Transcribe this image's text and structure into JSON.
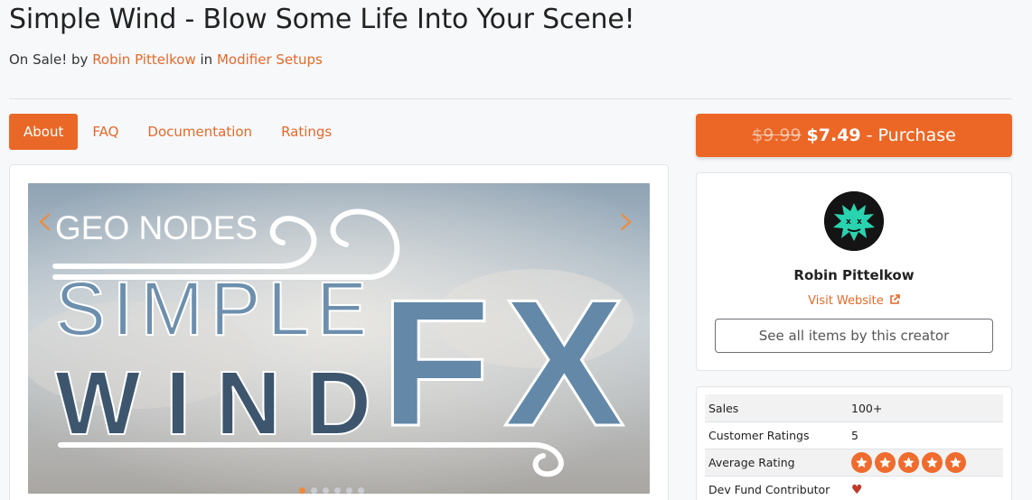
{
  "page": {
    "title": "Simple Wind - Blow Some Life Into Your Scene!",
    "status": "On Sale!",
    "by_word": "by",
    "author": "Robin Pittelkow",
    "in_word": "in",
    "category": "Modifier Setups"
  },
  "tabs": [
    {
      "label": "About",
      "active": true
    },
    {
      "label": "FAQ",
      "active": false
    },
    {
      "label": "Documentation",
      "active": false
    },
    {
      "label": "Ratings",
      "active": false
    }
  ],
  "hero": {
    "line1": "GEO NODES",
    "line2": "SIMPLE",
    "line3": "WIND",
    "line4": "FX",
    "slide_count": 6,
    "active_slide": 0
  },
  "purchase": {
    "old_price": "$9.99",
    "new_price": "$7.49",
    "label": "- Purchase",
    "accent": "#ec6726"
  },
  "creator": {
    "name": "Robin Pittelkow",
    "visit_label": "Visit Website",
    "see_all_label": "See all items by this creator"
  },
  "stats": {
    "sales_label": "Sales",
    "sales_value": "100+",
    "ratings_label": "Customer Ratings",
    "ratings_value": "5",
    "avg_label": "Average Rating",
    "avg_stars": 5,
    "devfund_label": "Dev Fund Contributor",
    "devfund_icon": "heart-icon"
  }
}
